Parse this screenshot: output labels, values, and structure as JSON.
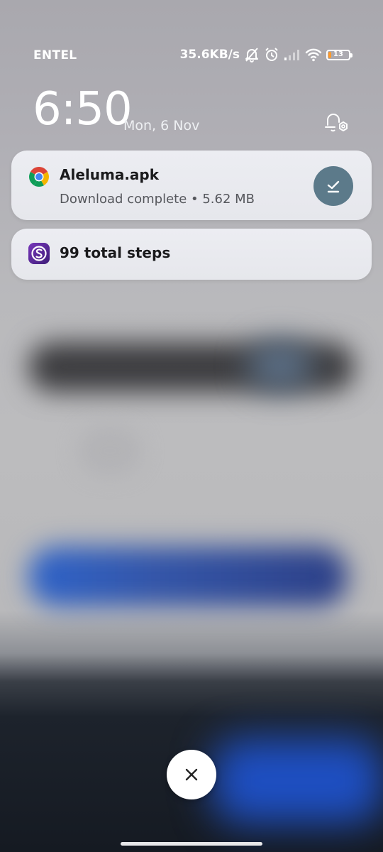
{
  "status_bar": {
    "carrier": "ENTEL",
    "net_speed": "35.6KB/s",
    "battery_level": "13",
    "battery_fraction": 0.13,
    "icons": [
      "silent-icon",
      "alarm-icon",
      "signal-icon",
      "wifi-icon",
      "battery-icon"
    ]
  },
  "lockscreen": {
    "time": "6:50",
    "date": "Mon, 6 Nov"
  },
  "notifications": [
    {
      "app_icon": "chrome-icon",
      "title": "Aleluma.apk",
      "subtitle": "Download complete • 5.62 MB",
      "action_icon": "install-check-icon"
    },
    {
      "app_icon": "steps-app-icon",
      "title": "99 total steps"
    }
  ],
  "controls": {
    "close_icon": "close-icon",
    "notif_settings_icon": "notification-settings-icon"
  },
  "colors": {
    "action_button": "#5c7a8a",
    "battery_low": "#ff9a2b",
    "steps_app": "#5b2a91"
  }
}
